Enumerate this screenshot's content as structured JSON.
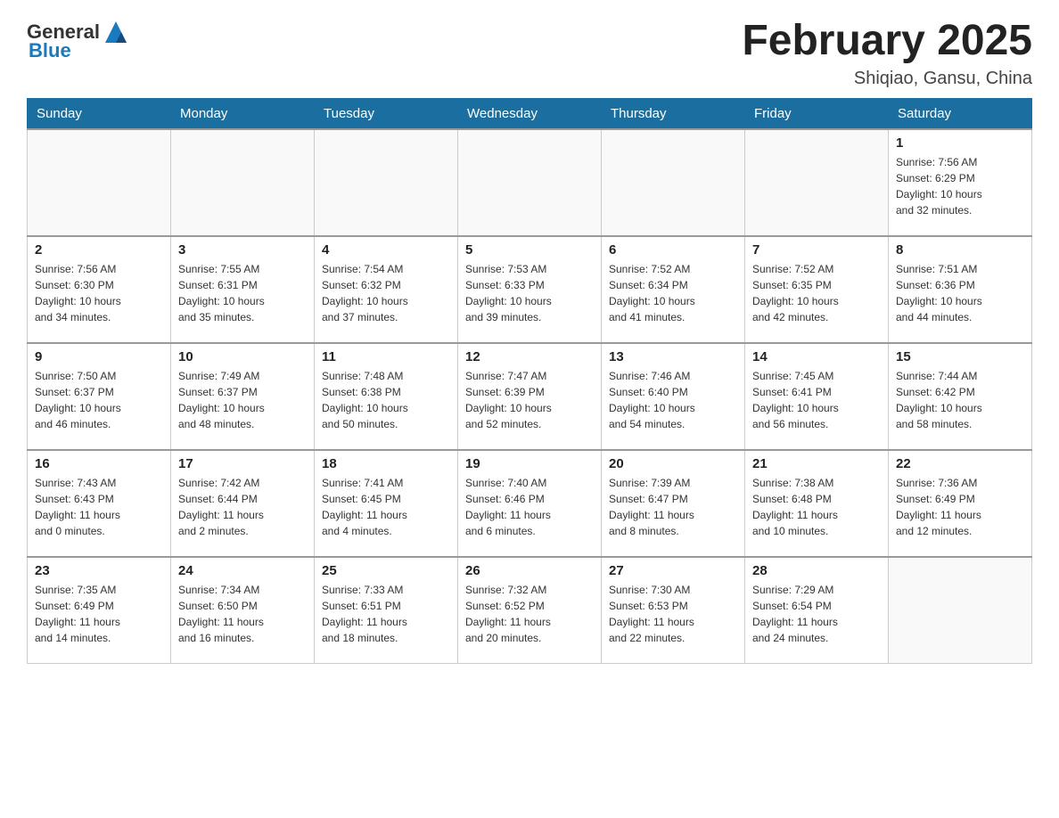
{
  "header": {
    "logo_general": "General",
    "logo_blue": "Blue",
    "month_title": "February 2025",
    "location": "Shiqiao, Gansu, China"
  },
  "days_of_week": [
    "Sunday",
    "Monday",
    "Tuesday",
    "Wednesday",
    "Thursday",
    "Friday",
    "Saturday"
  ],
  "weeks": [
    [
      {
        "day": "",
        "info": ""
      },
      {
        "day": "",
        "info": ""
      },
      {
        "day": "",
        "info": ""
      },
      {
        "day": "",
        "info": ""
      },
      {
        "day": "",
        "info": ""
      },
      {
        "day": "",
        "info": ""
      },
      {
        "day": "1",
        "info": "Sunrise: 7:56 AM\nSunset: 6:29 PM\nDaylight: 10 hours\nand 32 minutes."
      }
    ],
    [
      {
        "day": "2",
        "info": "Sunrise: 7:56 AM\nSunset: 6:30 PM\nDaylight: 10 hours\nand 34 minutes."
      },
      {
        "day": "3",
        "info": "Sunrise: 7:55 AM\nSunset: 6:31 PM\nDaylight: 10 hours\nand 35 minutes."
      },
      {
        "day": "4",
        "info": "Sunrise: 7:54 AM\nSunset: 6:32 PM\nDaylight: 10 hours\nand 37 minutes."
      },
      {
        "day": "5",
        "info": "Sunrise: 7:53 AM\nSunset: 6:33 PM\nDaylight: 10 hours\nand 39 minutes."
      },
      {
        "day": "6",
        "info": "Sunrise: 7:52 AM\nSunset: 6:34 PM\nDaylight: 10 hours\nand 41 minutes."
      },
      {
        "day": "7",
        "info": "Sunrise: 7:52 AM\nSunset: 6:35 PM\nDaylight: 10 hours\nand 42 minutes."
      },
      {
        "day": "8",
        "info": "Sunrise: 7:51 AM\nSunset: 6:36 PM\nDaylight: 10 hours\nand 44 minutes."
      }
    ],
    [
      {
        "day": "9",
        "info": "Sunrise: 7:50 AM\nSunset: 6:37 PM\nDaylight: 10 hours\nand 46 minutes."
      },
      {
        "day": "10",
        "info": "Sunrise: 7:49 AM\nSunset: 6:37 PM\nDaylight: 10 hours\nand 48 minutes."
      },
      {
        "day": "11",
        "info": "Sunrise: 7:48 AM\nSunset: 6:38 PM\nDaylight: 10 hours\nand 50 minutes."
      },
      {
        "day": "12",
        "info": "Sunrise: 7:47 AM\nSunset: 6:39 PM\nDaylight: 10 hours\nand 52 minutes."
      },
      {
        "day": "13",
        "info": "Sunrise: 7:46 AM\nSunset: 6:40 PM\nDaylight: 10 hours\nand 54 minutes."
      },
      {
        "day": "14",
        "info": "Sunrise: 7:45 AM\nSunset: 6:41 PM\nDaylight: 10 hours\nand 56 minutes."
      },
      {
        "day": "15",
        "info": "Sunrise: 7:44 AM\nSunset: 6:42 PM\nDaylight: 10 hours\nand 58 minutes."
      }
    ],
    [
      {
        "day": "16",
        "info": "Sunrise: 7:43 AM\nSunset: 6:43 PM\nDaylight: 11 hours\nand 0 minutes."
      },
      {
        "day": "17",
        "info": "Sunrise: 7:42 AM\nSunset: 6:44 PM\nDaylight: 11 hours\nand 2 minutes."
      },
      {
        "day": "18",
        "info": "Sunrise: 7:41 AM\nSunset: 6:45 PM\nDaylight: 11 hours\nand 4 minutes."
      },
      {
        "day": "19",
        "info": "Sunrise: 7:40 AM\nSunset: 6:46 PM\nDaylight: 11 hours\nand 6 minutes."
      },
      {
        "day": "20",
        "info": "Sunrise: 7:39 AM\nSunset: 6:47 PM\nDaylight: 11 hours\nand 8 minutes."
      },
      {
        "day": "21",
        "info": "Sunrise: 7:38 AM\nSunset: 6:48 PM\nDaylight: 11 hours\nand 10 minutes."
      },
      {
        "day": "22",
        "info": "Sunrise: 7:36 AM\nSunset: 6:49 PM\nDaylight: 11 hours\nand 12 minutes."
      }
    ],
    [
      {
        "day": "23",
        "info": "Sunrise: 7:35 AM\nSunset: 6:49 PM\nDaylight: 11 hours\nand 14 minutes."
      },
      {
        "day": "24",
        "info": "Sunrise: 7:34 AM\nSunset: 6:50 PM\nDaylight: 11 hours\nand 16 minutes."
      },
      {
        "day": "25",
        "info": "Sunrise: 7:33 AM\nSunset: 6:51 PM\nDaylight: 11 hours\nand 18 minutes."
      },
      {
        "day": "26",
        "info": "Sunrise: 7:32 AM\nSunset: 6:52 PM\nDaylight: 11 hours\nand 20 minutes."
      },
      {
        "day": "27",
        "info": "Sunrise: 7:30 AM\nSunset: 6:53 PM\nDaylight: 11 hours\nand 22 minutes."
      },
      {
        "day": "28",
        "info": "Sunrise: 7:29 AM\nSunset: 6:54 PM\nDaylight: 11 hours\nand 24 minutes."
      },
      {
        "day": "",
        "info": ""
      }
    ]
  ]
}
